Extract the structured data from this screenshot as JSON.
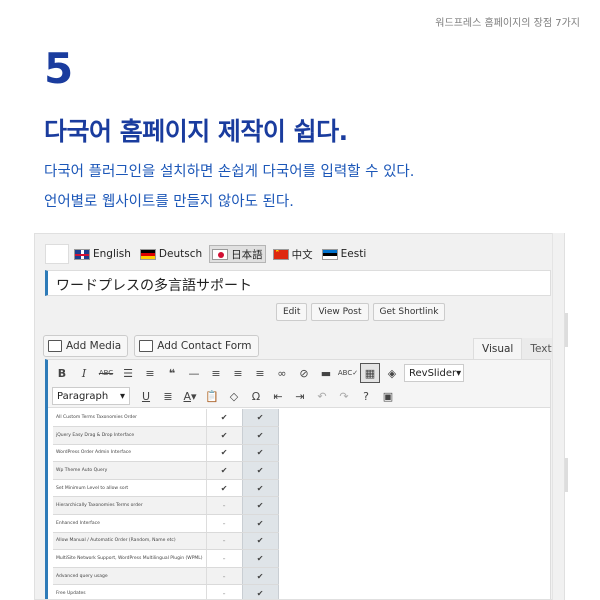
{
  "page": {
    "corner_label": "워드프레스 홈페이지의 장점 7가지",
    "number": "5",
    "headline": "다국어 홈페이지 제작이 쉽다.",
    "desc_line1": "다국어 플러그인을 설치하면 손쉽게 다국어를 입력할 수 있다.",
    "desc_line2": "언어별로 웹사이트를 만들지 않아도 된다."
  },
  "screenshot": {
    "languages": [
      {
        "label": "English",
        "flag": "flag-en",
        "active": false
      },
      {
        "label": "Deutsch",
        "flag": "flag-de",
        "active": false
      },
      {
        "label": "日本語",
        "flag": "flag-ja",
        "active": true
      },
      {
        "label": "中文",
        "flag": "flag-zh",
        "active": false
      },
      {
        "label": "Eesti",
        "flag": "flag-et",
        "active": false
      }
    ],
    "post_title": "ワードプレスの多言語サポート",
    "permalink_buttons": {
      "edit": "Edit",
      "view": "View Post",
      "shortlink": "Get Shortlink"
    },
    "media_buttons": {
      "add_media": "Add Media",
      "add_contact_form": "Add Contact Form"
    },
    "editor_tabs": {
      "visual": "Visual",
      "text": "Text"
    },
    "toolbar": {
      "format_select": "Paragraph",
      "revslider_select": "RevSlider",
      "row1_icons": [
        "bold-icon",
        "italic-icon",
        "strikethrough-icon",
        "bullet-list-icon",
        "numbered-list-icon",
        "blockquote-icon",
        "horizontal-rule-icon",
        "align-left-icon",
        "align-center-icon",
        "align-right-icon",
        "link-icon",
        "unlink-icon",
        "read-more-icon",
        "spellcheck-icon",
        "fullscreen-icon",
        "layers-icon"
      ],
      "row2_icons": [
        "underline-icon",
        "justify-icon",
        "text-color-icon",
        "paste-text-icon",
        "clear-formatting-icon",
        "special-character-icon",
        "outdent-icon",
        "indent-icon",
        "undo-icon",
        "redo-icon",
        "help-icon",
        "insert-image-icon"
      ]
    },
    "table_rows": [
      {
        "feature": "All Custom Terms Taxonomies Order",
        "free": "✔",
        "pro": "✔"
      },
      {
        "feature": "jQuery Easy Drag & Drop Interface",
        "free": "✔",
        "pro": "✔"
      },
      {
        "feature": "WordPress Order Admin Interface",
        "free": "✔",
        "pro": "✔"
      },
      {
        "feature": "Wp Theme Auto Query",
        "free": "✔",
        "pro": "✔"
      },
      {
        "feature": "Set Minimum Level to allow sort",
        "free": "✔",
        "pro": "✔"
      },
      {
        "feature": "Hierarchically Taxonomies Terms order",
        "free": "-",
        "pro": "✔"
      },
      {
        "feature": "Enhanced Interface",
        "free": "-",
        "pro": "✔"
      },
      {
        "feature": "Allow Manual / Automatic Order (Random, Name etc)",
        "free": "-",
        "pro": "✔"
      },
      {
        "feature": "MultiSite Network Support, WordPress Multilingual Plugin (WPML)",
        "free": "-",
        "pro": "✔"
      },
      {
        "feature": "Advanced query usage",
        "free": "-",
        "pro": "✔"
      },
      {
        "feature": "Free Updates",
        "free": "-",
        "pro": "✔"
      }
    ]
  }
}
